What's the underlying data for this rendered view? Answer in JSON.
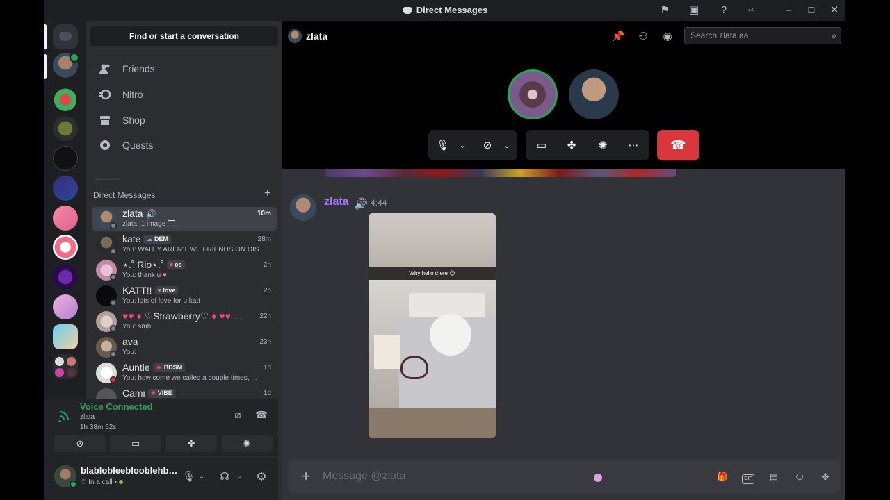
{
  "window": {
    "title": "Direct Messages"
  },
  "sidebar": {
    "find_label": "Find or start a conversation",
    "nav": [
      {
        "label": "Friends",
        "icon": "friends-icon"
      },
      {
        "label": "Nitro",
        "icon": "nitro-icon"
      },
      {
        "label": "Shop",
        "icon": "shop-icon"
      },
      {
        "label": "Quests",
        "icon": "quests-icon"
      }
    ],
    "dm_header": "Direct Messages",
    "dms": [
      {
        "name": "zlata",
        "sub": "zlata: 1 image",
        "time": "10m",
        "tag": ""
      },
      {
        "name": "kate",
        "sub": "You: WAIT Y AREN'T WE FRIENDS ON DIS...",
        "time": "28m",
        "tag": "DEM"
      },
      {
        "name": "⋆.˚ Rio⋆.˚",
        "sub": "You: thank u",
        "time": "2h",
        "tag": "ʚɞ"
      },
      {
        "name": "KATT!!",
        "sub": "You: lots of love for u katt",
        "time": "2h",
        "tag": "love"
      },
      {
        "name": "♡Strawberry♡",
        "sub": "You: smh",
        "time": "22h",
        "tag": ""
      },
      {
        "name": "ava",
        "sub": "You:",
        "time": "23h",
        "tag": ""
      },
      {
        "name": "Auntie",
        "sub": "You: how come we called a couple times, ...",
        "time": "1d",
        "tag": "BDSM"
      },
      {
        "name": "Cami",
        "sub": "",
        "time": "1d",
        "tag": "VIBE"
      }
    ]
  },
  "voice": {
    "status": "Voice Connected",
    "channel": "zlata",
    "elapsed": "1h 38m 52s"
  },
  "user": {
    "name": "blablobleeblooblehblah",
    "status": "In a call •"
  },
  "channel": {
    "name": "zlata",
    "search_placeholder": "Search zlata.aa"
  },
  "message": {
    "author": "zlata",
    "time": "4:44",
    "image_caption": "Why hello there 😊",
    "author_color": "#a970ff"
  },
  "composer": {
    "placeholder": "Message @zlata"
  },
  "colors": {
    "hangup": "#da373c",
    "voice_connected": "#23a55a",
    "online": "#23a55a"
  }
}
